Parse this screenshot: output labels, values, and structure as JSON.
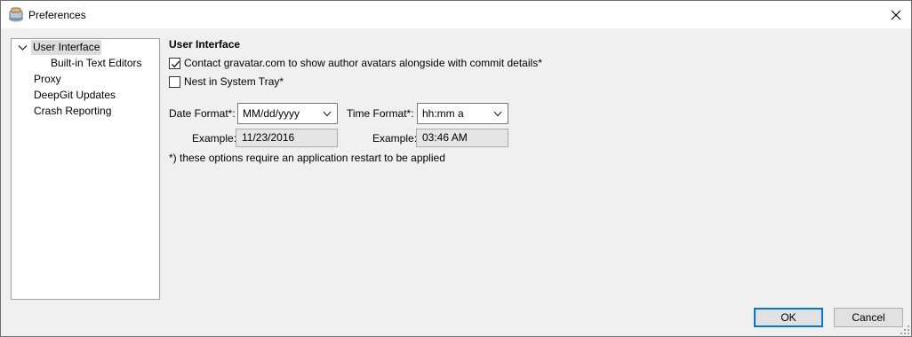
{
  "window": {
    "title": "Preferences",
    "icon": "app-icon"
  },
  "tree": {
    "items": [
      {
        "label": "User Interface",
        "level": 0,
        "selected": true,
        "expanded": true
      },
      {
        "label": "Built-in Text Editors",
        "level": 1
      },
      {
        "label": "Proxy",
        "level": 0
      },
      {
        "label": "DeepGit Updates",
        "level": 0
      },
      {
        "label": "Crash Reporting",
        "level": 0
      }
    ]
  },
  "panel": {
    "title": "User Interface",
    "gravatar": {
      "label": "Contact gravatar.com to show author avatars alongside with commit details*",
      "checked": true
    },
    "tray": {
      "label": "Nest in System Tray*",
      "checked": false
    },
    "date_format": {
      "label": "Date Format*:",
      "value": "MM/dd/yyyy"
    },
    "time_format": {
      "label": "Time Format*:",
      "value": "hh:mm a"
    },
    "date_example": {
      "label": "Example:",
      "value": "11/23/2016"
    },
    "time_example": {
      "label": "Example:",
      "value": "03:46 AM"
    },
    "note": "*) these options require an application restart to be applied"
  },
  "buttons": {
    "ok": "OK",
    "cancel": "Cancel"
  },
  "colors": {
    "focus_border": "#0078d7",
    "selection": "#dcdcdc"
  }
}
